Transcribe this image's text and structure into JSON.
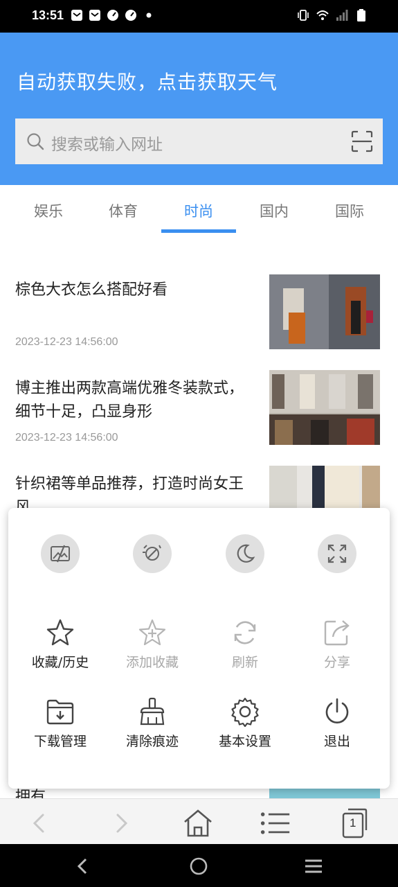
{
  "status_bar": {
    "time": "13:51",
    "left_icons": [
      "mail-icon",
      "mail-icon",
      "speed-icon",
      "speed-icon",
      "dot-icon"
    ],
    "right_icons": [
      "vibrate-icon",
      "wifi-icon",
      "signal-icon",
      "battery-icon"
    ]
  },
  "header": {
    "weather_text": "自动获取失败，点击获取天气",
    "search_placeholder": "搜索或输入网址",
    "background_color": "#4a99f3"
  },
  "tabs": [
    {
      "label": "娱乐",
      "active": false
    },
    {
      "label": "体育",
      "active": false
    },
    {
      "label": "时尚",
      "active": true
    },
    {
      "label": "国内",
      "active": false
    },
    {
      "label": "国际",
      "active": false
    }
  ],
  "news": [
    {
      "title": "棕色大衣怎么搭配好看",
      "time": "2023-12-23 14:56:00"
    },
    {
      "title": "博主推出两款高端优雅冬装款式，细节十足，凸显身形",
      "time": "2023-12-23 14:56:00"
    },
    {
      "title": "针织裙等单品推荐，打造时尚女王风",
      "time": ""
    }
  ],
  "peek_text": "拥有",
  "menu": {
    "top_row": [
      {
        "icon": "no-image-icon"
      },
      {
        "icon": "no-ads-icon"
      },
      {
        "icon": "night-mode-icon"
      },
      {
        "icon": "fullscreen-icon"
      }
    ],
    "items": [
      {
        "label": "收藏/历史",
        "icon": "star-icon",
        "enabled": true
      },
      {
        "label": "添加收藏",
        "icon": "add-star-icon",
        "enabled": false
      },
      {
        "label": "刷新",
        "icon": "refresh-icon",
        "enabled": false
      },
      {
        "label": "分享",
        "icon": "share-icon",
        "enabled": false
      },
      {
        "label": "下载管理",
        "icon": "download-folder-icon",
        "enabled": true
      },
      {
        "label": "清除痕迹",
        "icon": "broom-icon",
        "enabled": true
      },
      {
        "label": "基本设置",
        "icon": "gear-icon",
        "enabled": true
      },
      {
        "label": "退出",
        "icon": "power-icon",
        "enabled": true
      }
    ]
  },
  "toolbar": {
    "tab_count": "1"
  },
  "accent_color": "#3a8ff0"
}
